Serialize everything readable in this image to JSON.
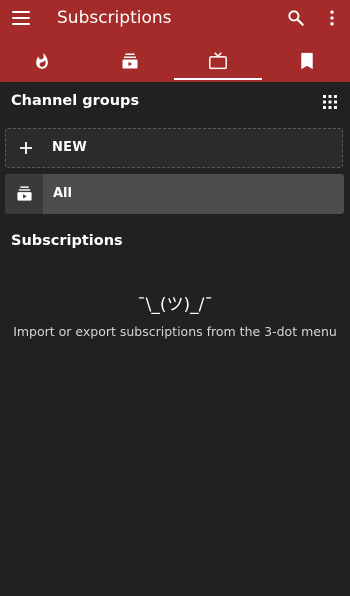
{
  "app": {
    "title": "Subscriptions",
    "accent_color": "#a52a2a",
    "background_color": "#212121"
  },
  "toolbar": {
    "menu_icon": "hamburger-menu-icon",
    "search_icon": "search-icon",
    "more_icon": "more-vert-icon"
  },
  "tabs": [
    {
      "icon": "fire-icon",
      "selected": false
    },
    {
      "icon": "subscriptions-icon",
      "selected": false
    },
    {
      "icon": "tv-icon",
      "selected": true
    },
    {
      "icon": "bookmark-icon",
      "selected": false
    }
  ],
  "channel_groups": {
    "header": "Channel groups",
    "grid_icon": "grid-view-icon",
    "new_label": "NEW",
    "items": [
      {
        "label": "All",
        "icon": "subscriptions-icon"
      }
    ]
  },
  "subscriptions": {
    "header": "Subscriptions",
    "empty_emoticon": "¯\\_(ツ)_/¯",
    "empty_message": "Import or export subscriptions from the 3-dot menu"
  }
}
